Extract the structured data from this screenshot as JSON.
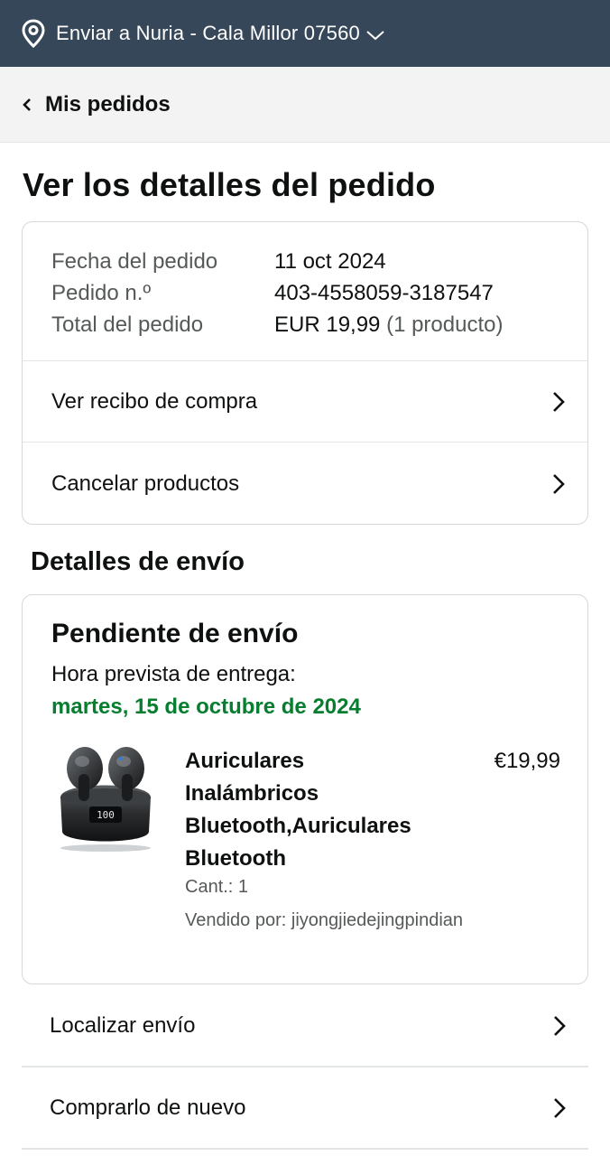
{
  "topbar": {
    "deliver_text": "Enviar a Nuria - Cala Millor 07560",
    "icons": [
      "location-pin-icon",
      "chevron-down-icon"
    ]
  },
  "subheader": {
    "back_label": "Mis pedidos"
  },
  "page": {
    "title": "Ver los detalles del pedido"
  },
  "summary": {
    "date_label": "Fecha del pedido",
    "date_value": "11 oct 2024",
    "order_label": "Pedido n.º",
    "order_value": "403-4558059-3187547",
    "total_label": "Total del pedido",
    "total_value": "EUR 19,99",
    "total_count": "(1 producto)",
    "receipt_link": "Ver recibo de compra",
    "cancel_link": "Cancelar productos"
  },
  "shipping": {
    "section_title": "Detalles de envío",
    "status": "Pendiente de envío",
    "eta_label": "Hora prevista de entrega:",
    "eta_date": "martes, 15 de octubre de 2024",
    "item": {
      "title_lines": [
        "Auriculares",
        "Inalámbricos",
        "Bluetooth,Auriculares",
        "Bluetooth"
      ],
      "price": "€19,99",
      "qty": "Cant.: 1",
      "seller": "Vendido por: jiyongjiedejingpindian",
      "image_display": "100"
    }
  },
  "actions": {
    "track": "Localizar envío",
    "buy_again": "Comprarlo de nuevo"
  },
  "colors": {
    "topbar": "#37475a",
    "eta_green": "#067d2f",
    "muted": "#565959",
    "border": "#d5d9d9"
  }
}
